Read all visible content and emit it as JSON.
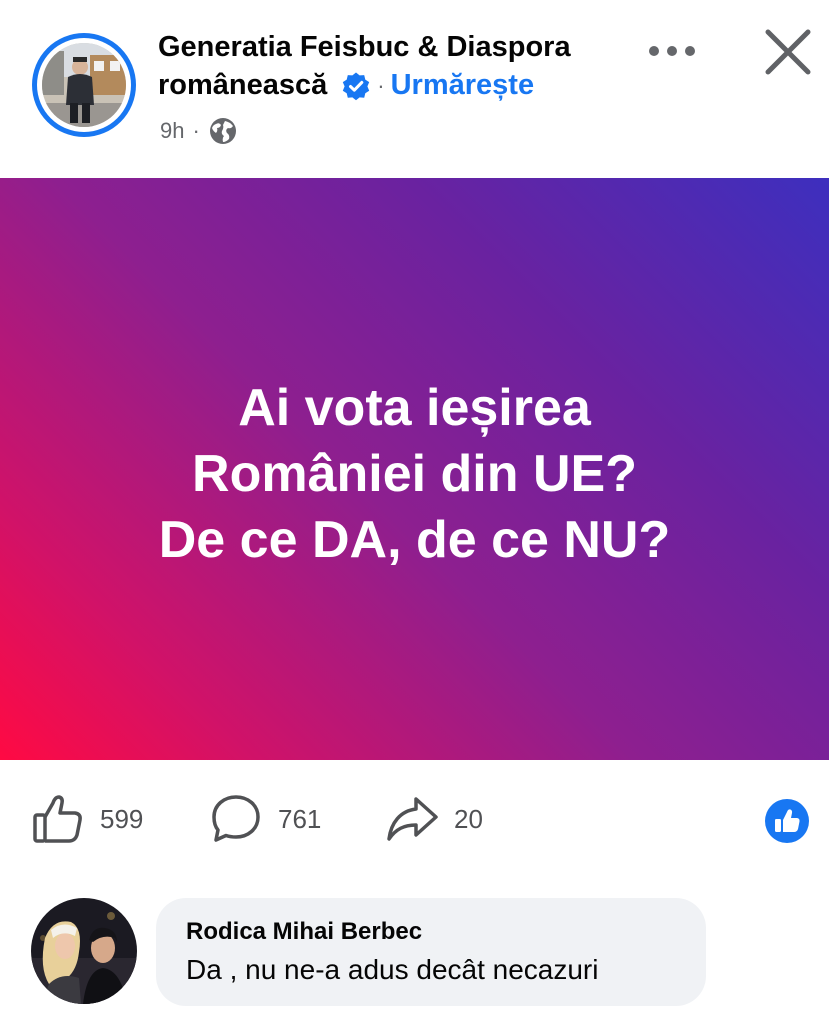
{
  "post": {
    "page_name_line1": "Generatia Feisbuc & Diaspora",
    "page_name_line2": "românească",
    "verified_icon": "verified-badge-icon",
    "separator": "·",
    "follow_label": "Urmărește",
    "time": "9h",
    "audience_icon": "globe-icon",
    "more_icon": "more-dots-icon",
    "close_icon": "close-icon"
  },
  "card": {
    "line1": "Ai vota ieșirea",
    "line2": "României din UE?",
    "line3": "De ce DA, de ce NU?",
    "gradient": [
      "#ff0a43",
      "#8e1f8f",
      "#3d2fbe"
    ]
  },
  "actions": {
    "likes": "599",
    "comments": "761",
    "shares": "20",
    "like_icon": "thumbs-up-icon",
    "comment_icon": "comment-bubble-icon",
    "share_icon": "share-arrow-icon",
    "reaction_icon": "like-reaction-icon"
  },
  "comment": {
    "author": "Rodica Mihai Berbec",
    "text": "Da , nu ne-a adus decât necazuri"
  },
  "colors": {
    "accent": "#1877f2",
    "bubble": "#f0f2f5",
    "secondary_text": "#65676b"
  }
}
